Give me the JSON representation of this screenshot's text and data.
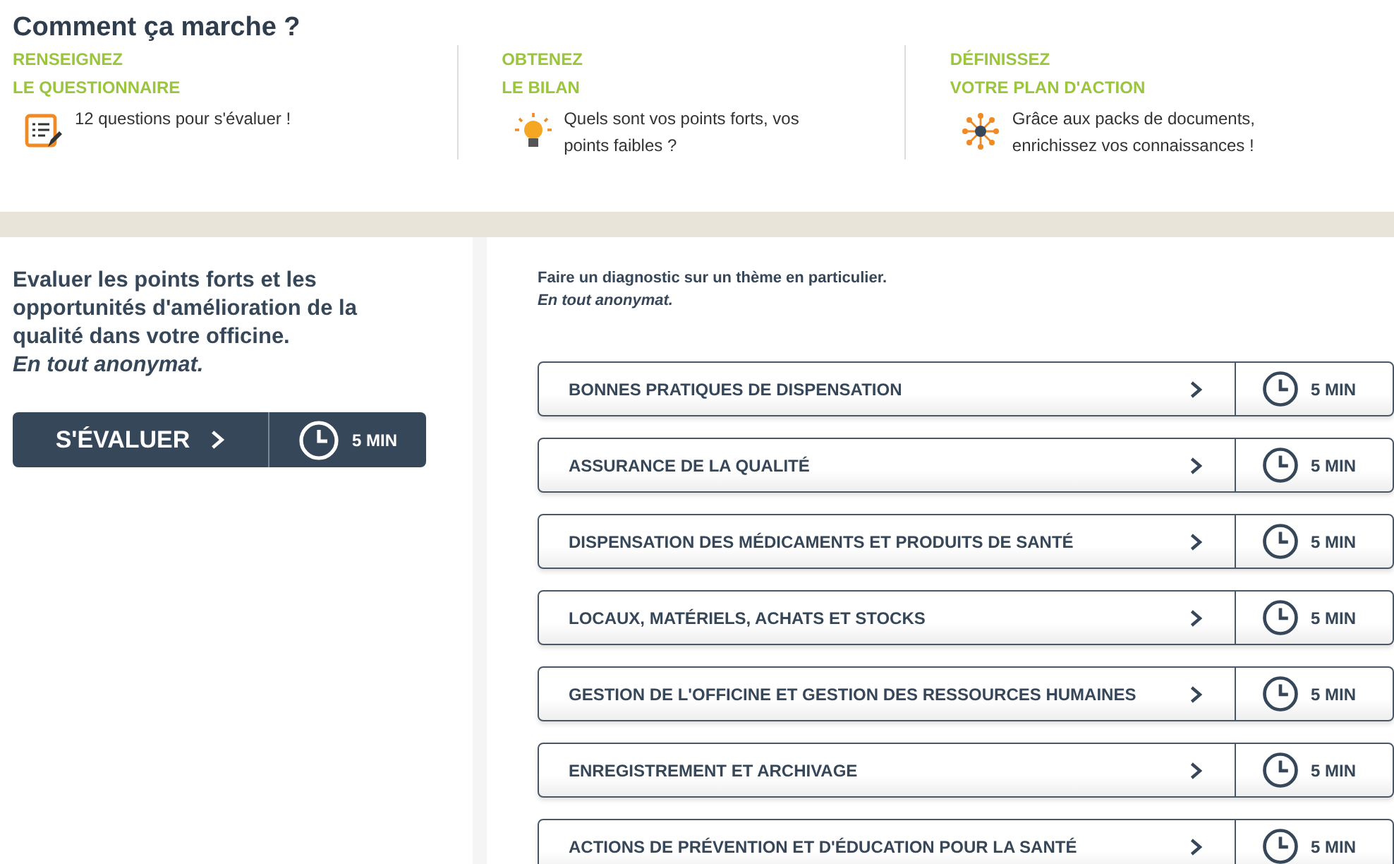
{
  "how_it_works": {
    "title": "Comment ça marche ?",
    "steps": [
      {
        "title_lines": [
          "RENSEIGNEZ",
          "LE QUESTIONNAIRE"
        ],
        "description": "12 questions pour s'évaluer !"
      },
      {
        "title_lines": [
          "OBTENEZ",
          "LE BILAN"
        ],
        "description": "Quels sont vos points forts, vos points faibles ?"
      },
      {
        "title_lines": [
          "DÉFINISSEZ",
          "VOTRE PLAN D'ACTION"
        ],
        "description": "Grâce aux packs de documents, enrichissez vos connaissances !"
      }
    ]
  },
  "evaluate": {
    "intro": "Evaluer les points forts et les opportunités d'amélioration de la qualité dans votre officine.",
    "note": "En tout anonymat.",
    "button": {
      "label": "S'ÉVALUER",
      "duration": "5 MIN"
    }
  },
  "themes": {
    "intro": "Faire un diagnostic sur un thème en particulier.",
    "note": "En tout anonymat.",
    "items": [
      {
        "label": "BONNES PRATIQUES DE DISPENSATION",
        "duration": "5 MIN"
      },
      {
        "label": "ASSURANCE DE LA QUALITÉ",
        "duration": "5 MIN"
      },
      {
        "label": "DISPENSATION DES MÉDICAMENTS ET PRODUITS DE SANTÉ",
        "duration": "5 MIN"
      },
      {
        "label": "LOCAUX, MATÉRIELS, ACHATS ET STOCKS",
        "duration": "5 MIN"
      },
      {
        "label": "GESTION DE L'OFFICINE ET GESTION DES RESSOURCES HUMAINES",
        "duration": "5 MIN"
      },
      {
        "label": "ENREGISTREMENT ET ARCHIVAGE",
        "duration": "5 MIN"
      },
      {
        "label": "ACTIONS DE PRÉVENTION ET D'ÉDUCATION POUR LA SANTÉ",
        "duration": "5 MIN"
      }
    ]
  }
}
